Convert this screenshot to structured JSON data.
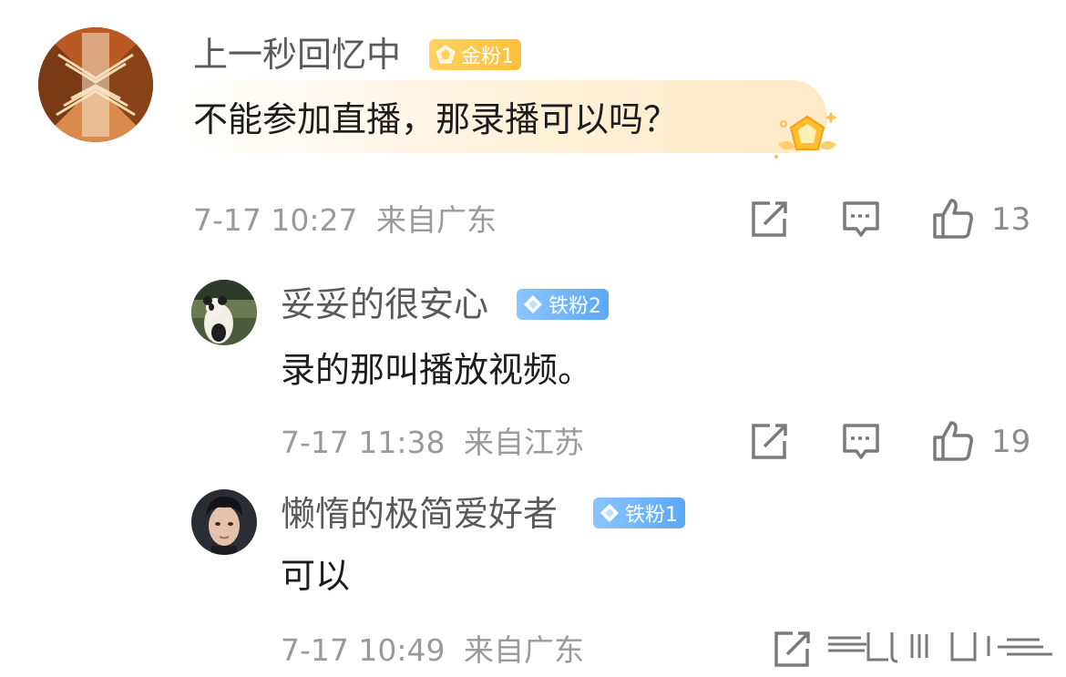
{
  "comments": [
    {
      "user": "上一秒回忆中",
      "badge": "金粉1",
      "text": "不能参加直播，那录播可以吗？",
      "time": "7-17 10:27",
      "location": "来自广东",
      "likes": "13"
    },
    {
      "user": "妥妥的很安心",
      "badge": "铁粉2",
      "text": "录的那叫播放视频。",
      "time": "7-17 11:38",
      "location": "来自江苏",
      "likes": "19"
    },
    {
      "user": "懒惰的极简爱好者",
      "badge": "铁粉1",
      "text": "可以",
      "time": "7-17 10:49",
      "location": "来自广东"
    }
  ],
  "icons": {
    "share": "share-icon",
    "reply": "comment-icon",
    "like": "thumbs-up-icon",
    "gold_badge": "gold-gem-icon",
    "iron_badge": "diamond-icon"
  },
  "colors": {
    "gold": "#ffc34a",
    "iron": "#6fb4fb",
    "meta_text": "#9a9a9a"
  }
}
